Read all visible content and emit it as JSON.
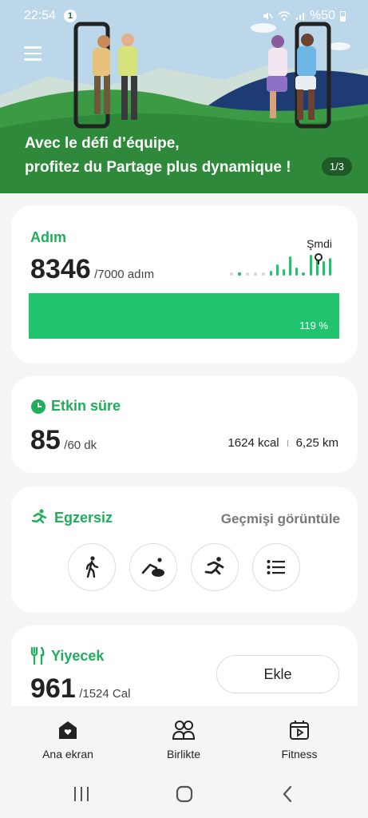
{
  "status_bar": {
    "time": "22:54",
    "notification_count": "1",
    "battery": "%50"
  },
  "banner": {
    "title_line1": "Avec le défi d’équipe,",
    "title_line2": "profitez du Partage plus dynamique !",
    "pager": "1/3"
  },
  "steps": {
    "title": "Adım",
    "value": "8346",
    "goal": "/7000 adım",
    "now_label": "Şmdi",
    "progress_fraction": 1.19,
    "progress_label": "119 %"
  },
  "active_time": {
    "title": "Etkin süre",
    "value": "85",
    "goal": "/60 dk",
    "calories": "1624 kcal",
    "distance": "6,25 km"
  },
  "exercise": {
    "title": "Egzersiz",
    "history_link": "Geçmişi görüntüle",
    "buttons": [
      "walking-icon",
      "cycling-icon",
      "running-icon",
      "list-icon"
    ]
  },
  "food": {
    "title": "Yiyecek",
    "value": "961",
    "goal": "/1524 Cal",
    "add_label": "Ekle"
  },
  "bottom_nav": {
    "home": "Ana ekran",
    "together": "Birlikte",
    "fitness": "Fitness"
  },
  "colors": {
    "accent": "#22c36e",
    "title_green": "#1fae59"
  }
}
